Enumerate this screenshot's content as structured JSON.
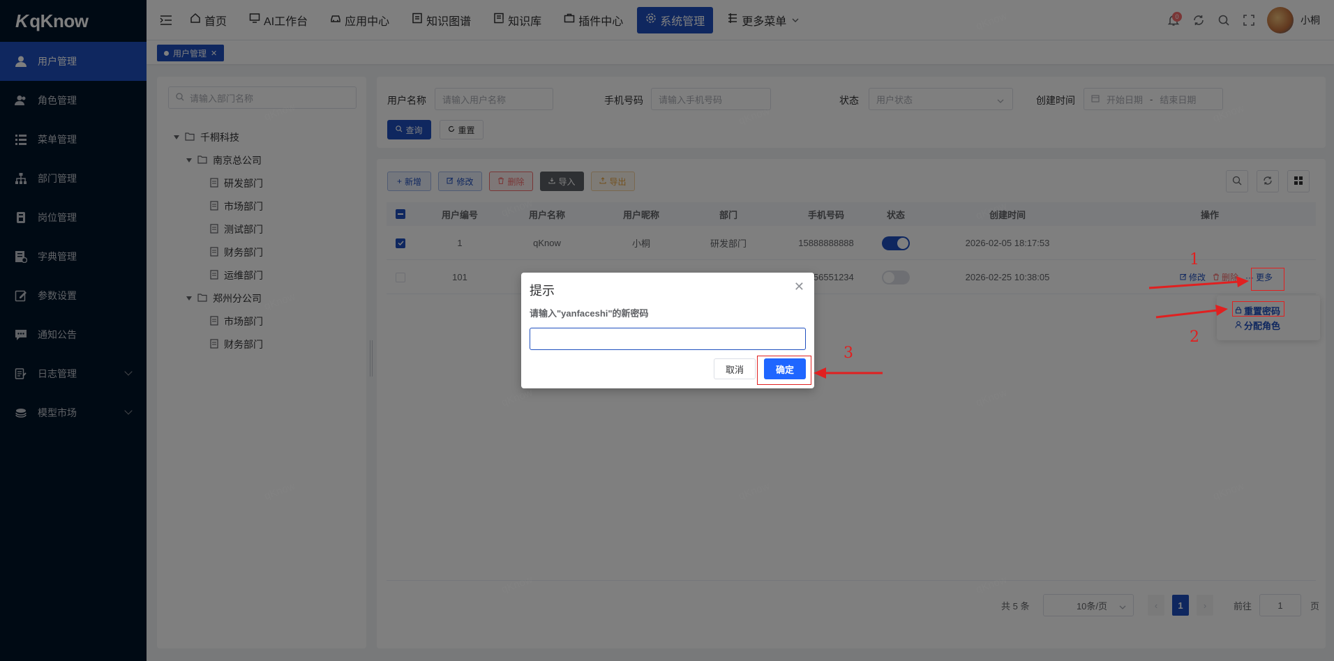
{
  "app": {
    "logo_text": "qKnow",
    "logo_mark": "K"
  },
  "sidebar": {
    "items": [
      {
        "label": "用户管理",
        "icon": "user-icon"
      },
      {
        "label": "角色管理",
        "icon": "role-icon"
      },
      {
        "label": "菜单管理",
        "icon": "menu-list-icon"
      },
      {
        "label": "部门管理",
        "icon": "org-tree-icon"
      },
      {
        "label": "岗位管理",
        "icon": "post-icon"
      },
      {
        "label": "字典管理",
        "icon": "dictionary-icon"
      },
      {
        "label": "参数设置",
        "icon": "edit-config-icon"
      },
      {
        "label": "通知公告",
        "icon": "message-icon"
      },
      {
        "label": "日志管理",
        "icon": "log-icon"
      },
      {
        "label": "模型市场",
        "icon": "model-market-icon"
      }
    ]
  },
  "topnav": {
    "items": [
      {
        "label": "首页",
        "icon": "home-icon"
      },
      {
        "label": "AI工作台",
        "icon": "monitor-icon"
      },
      {
        "label": "应用中心",
        "icon": "car-icon"
      },
      {
        "label": "知识图谱",
        "icon": "graph-icon"
      },
      {
        "label": "知识库",
        "icon": "book-icon"
      },
      {
        "label": "插件中心",
        "icon": "briefcase-icon"
      },
      {
        "label": "系统管理",
        "icon": "gear-icon"
      },
      {
        "label": "更多菜单",
        "icon": "more-menu-icon"
      }
    ],
    "notification_count": "0",
    "username": "小桐"
  },
  "tags": {
    "active": "用户管理"
  },
  "dept_tree": {
    "search_placeholder": "请输入部门名称",
    "root": "千桐科技",
    "nanjing": "南京总公司",
    "nanjing_children": [
      "研发部门",
      "市场部门",
      "测试部门",
      "财务部门",
      "运维部门"
    ],
    "zhengzhou": "郑州分公司",
    "zhengzhou_children": [
      "市场部门",
      "财务部门"
    ]
  },
  "search_form": {
    "username_label": "用户名称",
    "username_placeholder": "请输入用户名称",
    "phone_label": "手机号码",
    "phone_placeholder": "请输入手机号码",
    "status_label": "状态",
    "status_placeholder": "用户状态",
    "created_label": "创建时间",
    "start_placeholder": "开始日期",
    "date_sep": "-",
    "end_placeholder": "结束日期",
    "search_button": "查询",
    "reset_button": "重置"
  },
  "toolbar": {
    "add": "新增",
    "edit": "修改",
    "delete": "删除",
    "import": "导入",
    "export": "导出"
  },
  "table": {
    "columns": [
      "用户编号",
      "用户名称",
      "用户昵称",
      "部门",
      "手机号码",
      "状态",
      "创建时间",
      "操作"
    ],
    "rows": [
      {
        "id": "1",
        "name": "qKnow",
        "nick": "小桐",
        "dept": "研发部门",
        "phone": "15888888888",
        "enabled": true,
        "created": "2026-02-05 18:17:53",
        "checked": true
      },
      {
        "id": "101",
        "name": "",
        "nick": "",
        "dept": "",
        "phone": "17356551234",
        "enabled": false,
        "created": "2026-02-25 10:38:05",
        "checked": false
      }
    ],
    "row_actions": {
      "edit": "修改",
      "delete": "删除",
      "more": "更多"
    }
  },
  "more_dropdown": {
    "reset_password": "重置密码",
    "assign_role": "分配角色"
  },
  "pagination": {
    "total": "共 5 条",
    "page_size": "10条/页",
    "current_page": "1",
    "goto_label": "前往",
    "goto_value": "1",
    "page_suffix": "页"
  },
  "dialog": {
    "title": "提示",
    "message": "请输入\"yanfaceshi\"的新密码",
    "input_value": "",
    "cancel": "取消",
    "confirm": "确定"
  },
  "annotations": {
    "step1": "1",
    "step2": "2",
    "step3": "3"
  },
  "watermark": "qKnow",
  "colors": {
    "primary": "#1f4fbf",
    "sidebar_bg": "#001529",
    "danger": "#f56c6c",
    "annotation": "#e02020",
    "confirm_button": "#1f66ff"
  }
}
